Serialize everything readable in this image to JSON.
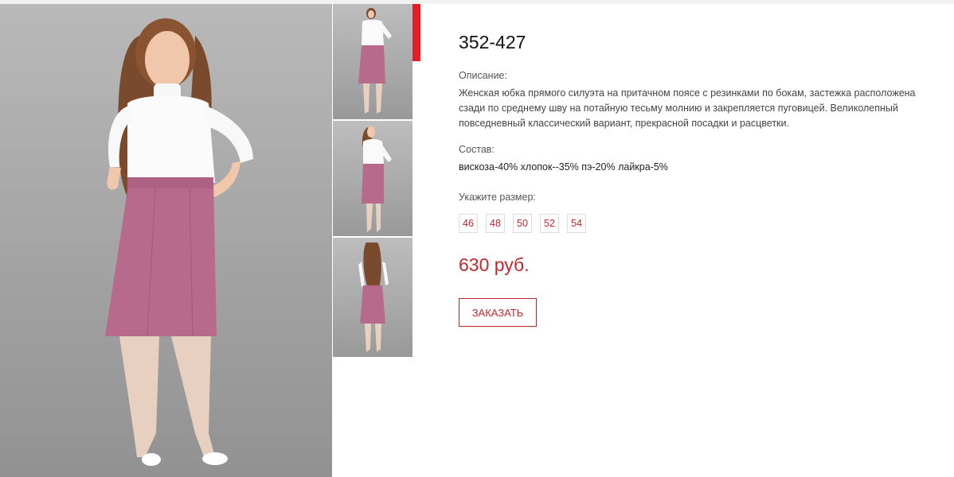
{
  "product": {
    "code": "352-427",
    "description_label": "Описание:",
    "description": "Женская юбка прямого силуэта на притачном поясе с резинками по бокам, застежка расположена сзади по среднему шву на потайную тесьму молнию и закрепляется пуговицей. Великолепный повседневный классический  вариант, прекрасной посадки и расцветки.",
    "composition_label": "Состав:",
    "composition": "вискоза-40% хлопок--35% пэ-20% лайкра-5%",
    "size_label": "Укажите размер:",
    "sizes": [
      "46",
      "48",
      "50",
      "52",
      "54"
    ],
    "price": "630 руб.",
    "order_label": "ЗАКАЗАТЬ"
  },
  "gallery": {
    "main_image": "model-front-photo",
    "thumbnails": [
      "model-front-thumb",
      "model-side-thumb",
      "model-back-thumb"
    ]
  },
  "colors": {
    "accent": "#c0282d",
    "tab": "#e31e24",
    "skirt": "#b86a8c",
    "background_gray": "#a7a7a8"
  }
}
